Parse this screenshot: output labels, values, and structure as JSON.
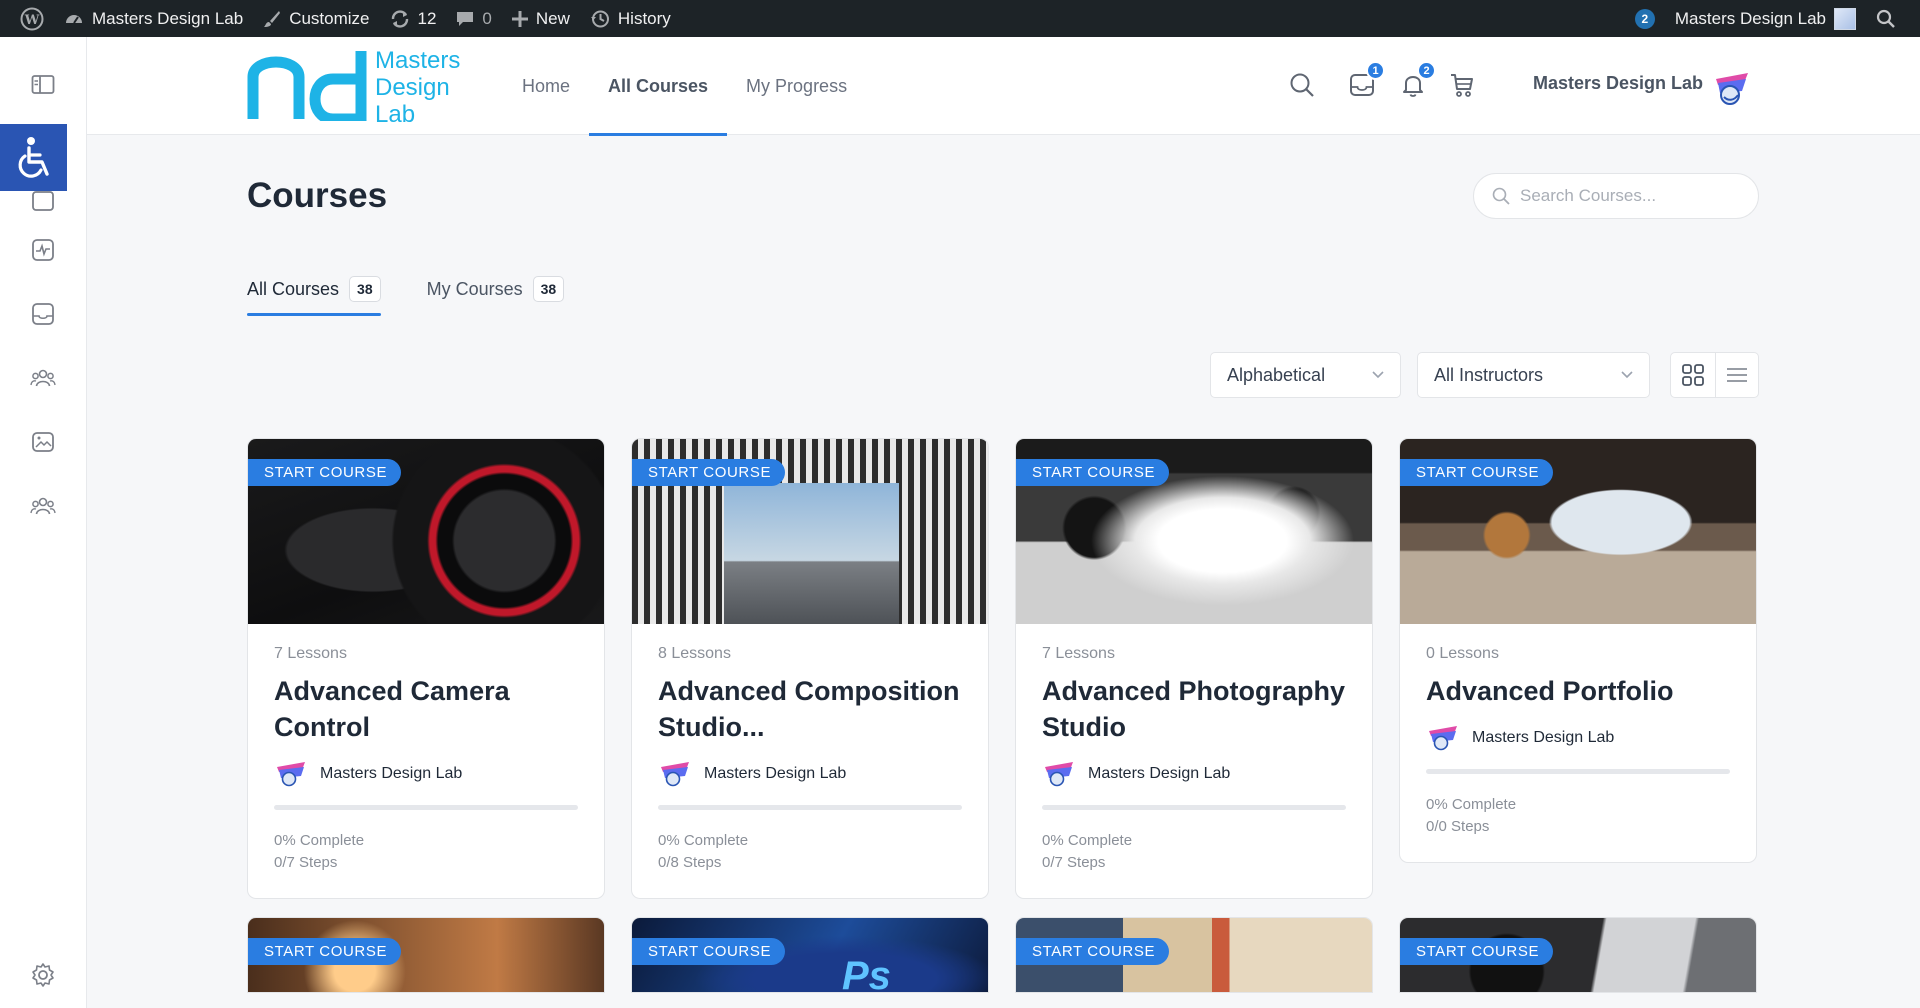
{
  "adminbar": {
    "site_name": "Masters Design Lab",
    "customize": "Customize",
    "updates_count": "12",
    "comments_count": "0",
    "new_label": "New",
    "history_label": "History",
    "notifications_count": "2",
    "account_name": "Masters Design Lab"
  },
  "header": {
    "logo_line1": "Masters",
    "logo_line2": "Design",
    "logo_line3": "Lab",
    "nav": [
      {
        "label": "Home"
      },
      {
        "label": "All Courses",
        "active": true
      },
      {
        "label": "My Progress"
      }
    ],
    "messages_count": "1",
    "notifications_count": "2",
    "user_name": "Masters Design Lab"
  },
  "page": {
    "title": "Courses",
    "search_placeholder": "Search Courses...",
    "tabs": [
      {
        "label": "All Courses",
        "count": "38",
        "active": true
      },
      {
        "label": "My Courses",
        "count": "38"
      }
    ],
    "order_select": "Alphabetical",
    "instructor_select": "All Instructors"
  },
  "courses": [
    {
      "badge": "START COURSE",
      "lessons": "7 Lessons",
      "title": "Advanced Camera Control",
      "author": "Masters Design Lab",
      "progress_pct": 0,
      "complete": "0% Complete",
      "steps": "0/7 Steps"
    },
    {
      "badge": "START COURSE",
      "lessons": "8 Lessons",
      "title": "Advanced Composition Studio...",
      "author": "Masters Design Lab",
      "progress_pct": 0,
      "complete": "0% Complete",
      "steps": "0/8 Steps"
    },
    {
      "badge": "START COURSE",
      "lessons": "7 Lessons",
      "title": "Advanced Photography Studio",
      "author": "Masters Design Lab",
      "progress_pct": 0,
      "complete": "0% Complete",
      "steps": "0/7 Steps"
    },
    {
      "badge": "START COURSE",
      "lessons": "0 Lessons",
      "title": "Advanced Portfolio",
      "author": "Masters Design Lab",
      "progress_pct": 0,
      "complete": "0% Complete",
      "steps": "0/0 Steps"
    },
    {
      "badge": "START COURSE"
    },
    {
      "badge": "START COURSE",
      "thumb_text": "Ps"
    },
    {
      "badge": "START COURSE"
    },
    {
      "badge": "START COURSE"
    }
  ],
  "colors": {
    "accent": "#2a7de1",
    "admin_bar": "#1d2327",
    "accessibility": "#2a55b3",
    "logo": "#1eb3e6"
  }
}
